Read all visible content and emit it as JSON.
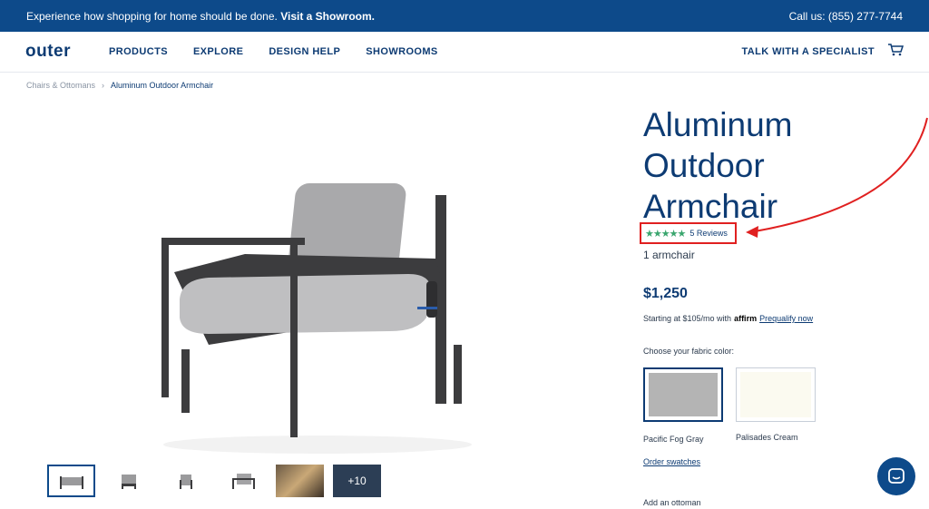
{
  "topbar": {
    "message": "Experience how shopping for home should be done.",
    "cta": "Visit a Showroom.",
    "phone": "Call us: (855) 277-7744"
  },
  "nav": {
    "logo": "outer",
    "items": [
      "PRODUCTS",
      "EXPLORE",
      "DESIGN HELP",
      "SHOWROOMS"
    ],
    "specialist": "TALK WITH A SPECIALIST",
    "cart_icon": "cart-icon"
  },
  "breadcrumb": {
    "parent": "Chairs & Ottomans",
    "separator": "›",
    "current": "Aluminum Outdoor Armchair"
  },
  "product": {
    "title": "Aluminum Outdoor Armchair",
    "stars": "★★★★★",
    "reviews": "5 Reviews",
    "pack": "1 armchair",
    "price": "$1,250",
    "finance_prefix": "Starting at $105/mo with",
    "finance_brand": "affirm",
    "finance_link": "Prequalify now",
    "fabric_label": "Choose your fabric color:",
    "swatches": [
      {
        "name": "Pacific Fog Gray",
        "color": "#b4b4b4"
      },
      {
        "name": "Palisades Cream",
        "color": "#fbfaf0"
      }
    ],
    "order_swatches": "Order swatches",
    "ottoman": "Add an ottoman"
  },
  "gallery": {
    "more_count": "+10"
  },
  "colors": {
    "brand": "#0d4a8a",
    "highlight": "#e02020",
    "star": "#3aa66e"
  }
}
